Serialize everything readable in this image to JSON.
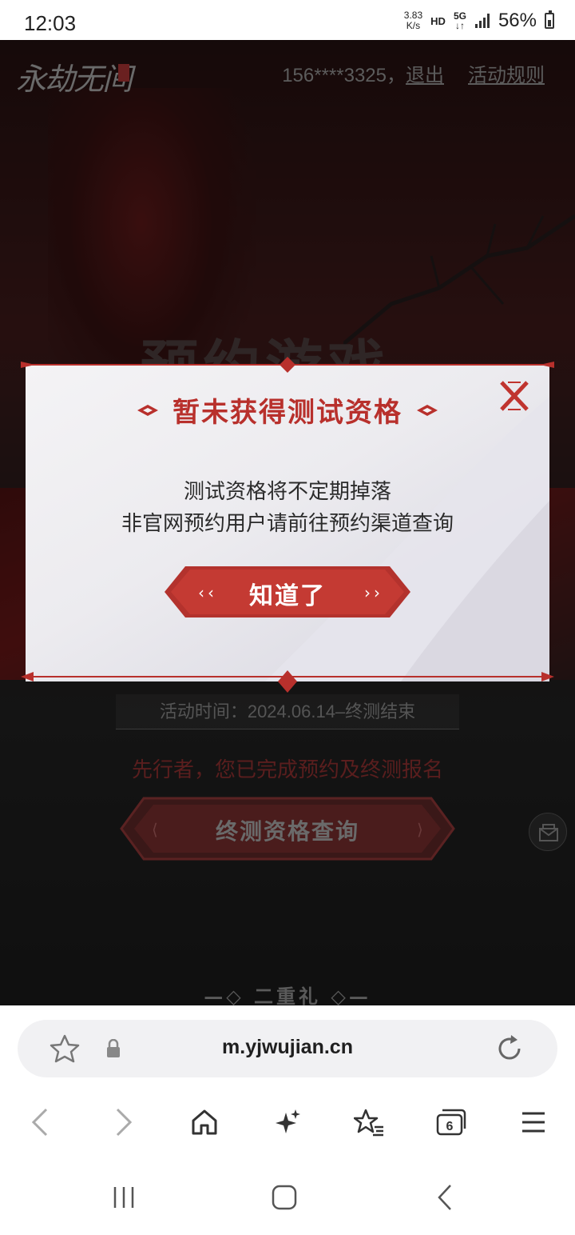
{
  "status_bar": {
    "time": "12:03",
    "net_speed_value": "3.83",
    "net_speed_unit": "K/s",
    "hd": "HD",
    "network": "5G",
    "battery": "56%"
  },
  "page": {
    "logo_text": "永劫无间",
    "user_phone": "156****3325，",
    "logout_label": "退出",
    "rules_label": "活动规则",
    "bg_title": "预约游戏",
    "activity_time": "活动时间：2024.06.14–终测结束",
    "status_text": "先行者，您已完成预约及终测报名",
    "query_button": "终测资格查询",
    "section_title": "二重礼"
  },
  "modal": {
    "title": "暂未获得测试资格",
    "message_line1": "测试资格将不定期掉落",
    "message_line2": "非官网预约用户请前往预约渠道查询",
    "ok_button": "知道了"
  },
  "browser": {
    "url": "m.yjwujian.cn",
    "tab_count": "6"
  },
  "icons": {
    "bookmark": "star-icon",
    "lock": "lock-icon",
    "reload": "reload-icon",
    "back": "back-icon",
    "forward": "forward-icon",
    "home": "home-icon",
    "ai": "sparkle-icon",
    "bookmarks": "bookmarks-list-icon",
    "tabs": "tabs-icon",
    "menu": "menu-icon"
  },
  "colors": {
    "accent_red": "#b8302c",
    "modal_bg": "#ecebef",
    "browser_bg": "#ffffff"
  }
}
